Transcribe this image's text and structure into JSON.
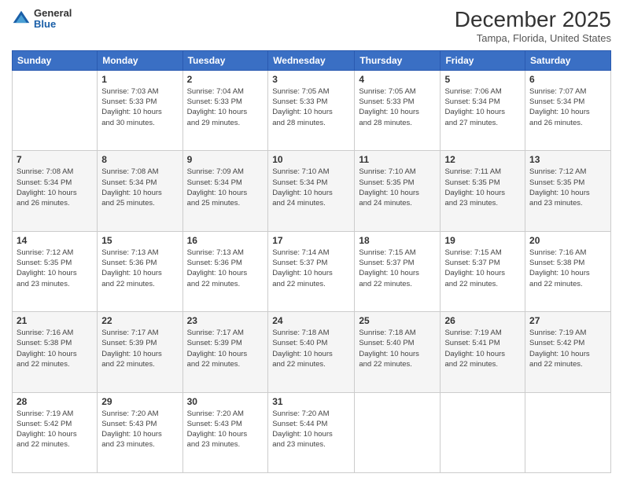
{
  "logo": {
    "general": "General",
    "blue": "Blue"
  },
  "title": "December 2025",
  "subtitle": "Tampa, Florida, United States",
  "headers": [
    "Sunday",
    "Monday",
    "Tuesday",
    "Wednesday",
    "Thursday",
    "Friday",
    "Saturday"
  ],
  "weeks": [
    [
      {
        "day": "",
        "info": ""
      },
      {
        "day": "1",
        "info": "Sunrise: 7:03 AM\nSunset: 5:33 PM\nDaylight: 10 hours\nand 30 minutes."
      },
      {
        "day": "2",
        "info": "Sunrise: 7:04 AM\nSunset: 5:33 PM\nDaylight: 10 hours\nand 29 minutes."
      },
      {
        "day": "3",
        "info": "Sunrise: 7:05 AM\nSunset: 5:33 PM\nDaylight: 10 hours\nand 28 minutes."
      },
      {
        "day": "4",
        "info": "Sunrise: 7:05 AM\nSunset: 5:33 PM\nDaylight: 10 hours\nand 28 minutes."
      },
      {
        "day": "5",
        "info": "Sunrise: 7:06 AM\nSunset: 5:34 PM\nDaylight: 10 hours\nand 27 minutes."
      },
      {
        "day": "6",
        "info": "Sunrise: 7:07 AM\nSunset: 5:34 PM\nDaylight: 10 hours\nand 26 minutes."
      }
    ],
    [
      {
        "day": "7",
        "info": "Sunrise: 7:08 AM\nSunset: 5:34 PM\nDaylight: 10 hours\nand 26 minutes."
      },
      {
        "day": "8",
        "info": "Sunrise: 7:08 AM\nSunset: 5:34 PM\nDaylight: 10 hours\nand 25 minutes."
      },
      {
        "day": "9",
        "info": "Sunrise: 7:09 AM\nSunset: 5:34 PM\nDaylight: 10 hours\nand 25 minutes."
      },
      {
        "day": "10",
        "info": "Sunrise: 7:10 AM\nSunset: 5:34 PM\nDaylight: 10 hours\nand 24 minutes."
      },
      {
        "day": "11",
        "info": "Sunrise: 7:10 AM\nSunset: 5:35 PM\nDaylight: 10 hours\nand 24 minutes."
      },
      {
        "day": "12",
        "info": "Sunrise: 7:11 AM\nSunset: 5:35 PM\nDaylight: 10 hours\nand 23 minutes."
      },
      {
        "day": "13",
        "info": "Sunrise: 7:12 AM\nSunset: 5:35 PM\nDaylight: 10 hours\nand 23 minutes."
      }
    ],
    [
      {
        "day": "14",
        "info": "Sunrise: 7:12 AM\nSunset: 5:35 PM\nDaylight: 10 hours\nand 23 minutes."
      },
      {
        "day": "15",
        "info": "Sunrise: 7:13 AM\nSunset: 5:36 PM\nDaylight: 10 hours\nand 22 minutes."
      },
      {
        "day": "16",
        "info": "Sunrise: 7:13 AM\nSunset: 5:36 PM\nDaylight: 10 hours\nand 22 minutes."
      },
      {
        "day": "17",
        "info": "Sunrise: 7:14 AM\nSunset: 5:37 PM\nDaylight: 10 hours\nand 22 minutes."
      },
      {
        "day": "18",
        "info": "Sunrise: 7:15 AM\nSunset: 5:37 PM\nDaylight: 10 hours\nand 22 minutes."
      },
      {
        "day": "19",
        "info": "Sunrise: 7:15 AM\nSunset: 5:37 PM\nDaylight: 10 hours\nand 22 minutes."
      },
      {
        "day": "20",
        "info": "Sunrise: 7:16 AM\nSunset: 5:38 PM\nDaylight: 10 hours\nand 22 minutes."
      }
    ],
    [
      {
        "day": "21",
        "info": "Sunrise: 7:16 AM\nSunset: 5:38 PM\nDaylight: 10 hours\nand 22 minutes."
      },
      {
        "day": "22",
        "info": "Sunrise: 7:17 AM\nSunset: 5:39 PM\nDaylight: 10 hours\nand 22 minutes."
      },
      {
        "day": "23",
        "info": "Sunrise: 7:17 AM\nSunset: 5:39 PM\nDaylight: 10 hours\nand 22 minutes."
      },
      {
        "day": "24",
        "info": "Sunrise: 7:18 AM\nSunset: 5:40 PM\nDaylight: 10 hours\nand 22 minutes."
      },
      {
        "day": "25",
        "info": "Sunrise: 7:18 AM\nSunset: 5:40 PM\nDaylight: 10 hours\nand 22 minutes."
      },
      {
        "day": "26",
        "info": "Sunrise: 7:19 AM\nSunset: 5:41 PM\nDaylight: 10 hours\nand 22 minutes."
      },
      {
        "day": "27",
        "info": "Sunrise: 7:19 AM\nSunset: 5:42 PM\nDaylight: 10 hours\nand 22 minutes."
      }
    ],
    [
      {
        "day": "28",
        "info": "Sunrise: 7:19 AM\nSunset: 5:42 PM\nDaylight: 10 hours\nand 22 minutes."
      },
      {
        "day": "29",
        "info": "Sunrise: 7:20 AM\nSunset: 5:43 PM\nDaylight: 10 hours\nand 23 minutes."
      },
      {
        "day": "30",
        "info": "Sunrise: 7:20 AM\nSunset: 5:43 PM\nDaylight: 10 hours\nand 23 minutes."
      },
      {
        "day": "31",
        "info": "Sunrise: 7:20 AM\nSunset: 5:44 PM\nDaylight: 10 hours\nand 23 minutes."
      },
      {
        "day": "",
        "info": ""
      },
      {
        "day": "",
        "info": ""
      },
      {
        "day": "",
        "info": ""
      }
    ]
  ]
}
